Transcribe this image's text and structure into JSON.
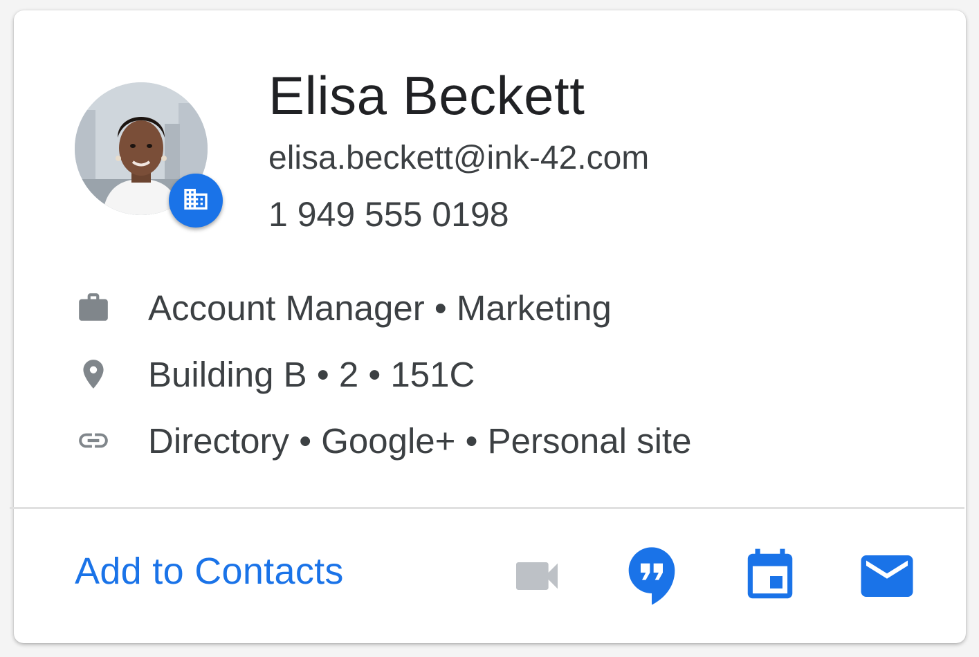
{
  "contact": {
    "name": "Elisa Beckett",
    "email": "elisa.beckett@ink-42.com",
    "phone": "1 949 555 0198"
  },
  "details": {
    "job": "Account Manager • Marketing",
    "location": "Building B • 2 • 151C",
    "links": "Directory • Google+ • Personal site"
  },
  "footer": {
    "add_label": "Add to Contacts"
  },
  "icons": {
    "badge": "building-icon",
    "job": "briefcase-icon",
    "location": "place-icon",
    "links": "link-icon",
    "video": "video-camera-icon",
    "chat": "hangouts-icon",
    "calendar": "calendar-icon",
    "email": "mail-icon"
  },
  "colors": {
    "accent": "#1a73e8",
    "disabled_icon": "#bdc1c6",
    "secondary_icon": "#5f6368",
    "text_primary": "#202124",
    "text_secondary": "#3c4043"
  }
}
